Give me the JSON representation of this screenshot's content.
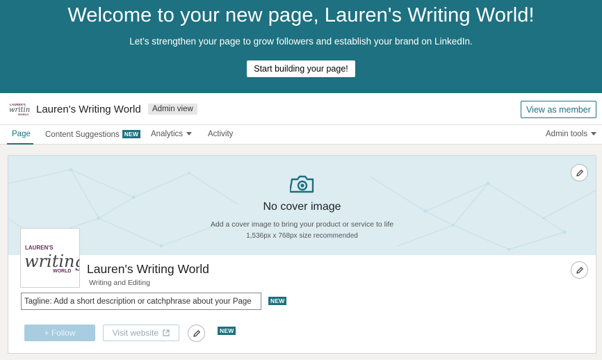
{
  "banner": {
    "title": "Welcome to your new page, Lauren's Writing World!",
    "subtitle": "Let’s strengthen your page to grow followers and establish your brand on LinkedIn.",
    "button": "Start building your page!"
  },
  "header": {
    "page_name": "Lauren's Writing World",
    "admin_badge": "Admin view",
    "view_as_member": "View as member"
  },
  "nav": {
    "tabs": [
      {
        "label": "Page",
        "active": true
      },
      {
        "label": "Content Suggestions",
        "badge": "NEW"
      },
      {
        "label": "Analytics",
        "dropdown": true
      },
      {
        "label": "Activity"
      }
    ],
    "admin_tools": "Admin tools"
  },
  "cover": {
    "icon": "camera-icon",
    "title": "No cover image",
    "description": "Add a cover image to bring your product or service to life",
    "size_hint": "1,536px x 768px size recommended"
  },
  "logo": {
    "text_top": "LAUREN'S",
    "text_script": "writing",
    "text_bottom": "WORLD",
    "color": "#6b2d5c"
  },
  "profile": {
    "name": "Lauren's Writing World",
    "industry": "Writing and Editing",
    "tagline_placeholder": "Tagline: Add a short description or catchphrase about your Page",
    "tagline_badge": "NEW",
    "follow_label": "+  Follow",
    "visit_label": "Visit website",
    "buttons_badge": "NEW"
  },
  "colors": {
    "brand": "#1d7180",
    "cover_bg": "#dcecf1"
  }
}
